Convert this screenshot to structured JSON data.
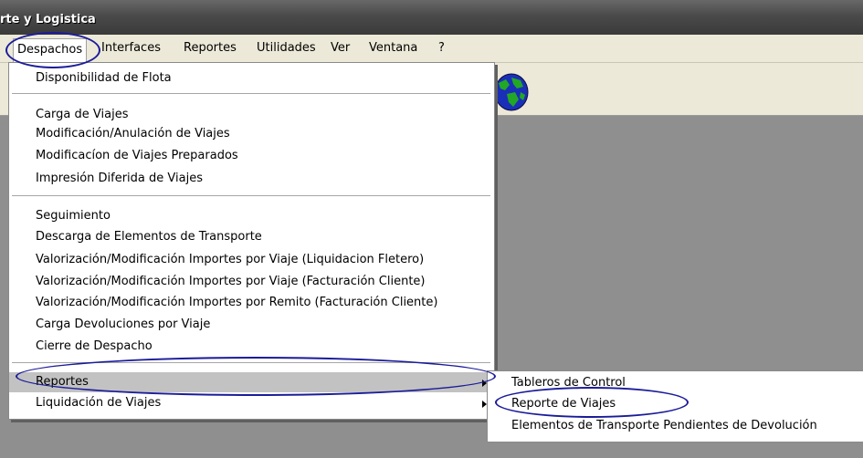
{
  "window": {
    "title": "rte y Logistica"
  },
  "menubar": {
    "items": [
      "Despachos",
      "Interfaces",
      "Reportes",
      "Utilidades",
      "Ver",
      "Ventana",
      "?"
    ]
  },
  "toolbar": {
    "icons": [
      "globe-icon"
    ]
  },
  "despachos_menu": {
    "group1": [
      "Disponibilidad de Flota"
    ],
    "group2": [
      "Carga de Viajes",
      "Modificación/Anulación de Viajes",
      "Modificacíon de Viajes Preparados",
      "Impresión Diferida de Viajes"
    ],
    "group3": [
      "Seguimiento",
      "Descarga de Elementos de Transporte",
      "Valorización/Modificación Importes por Viaje (Liquidacion Fletero)",
      "Valorización/Modificación Importes por Viaje (Facturación Cliente)",
      "Valorización/Modificación Importes por Remito (Facturación Cliente)",
      "Carga Devoluciones por Viaje",
      "Cierre de Despacho"
    ],
    "group4": [
      "Reportes",
      "Liquidación de Viajes"
    ]
  },
  "reportes_submenu": {
    "items": [
      "Tableros de Control",
      "Reporte de Viajes",
      "Elementos de Transporte Pendientes de Devolución"
    ]
  },
  "colors": {
    "annotation": "#1b1b9a",
    "highlight": "#c2c2c2",
    "menubar_bg": "#ece9d8",
    "workspace": "#8f8f8f"
  }
}
